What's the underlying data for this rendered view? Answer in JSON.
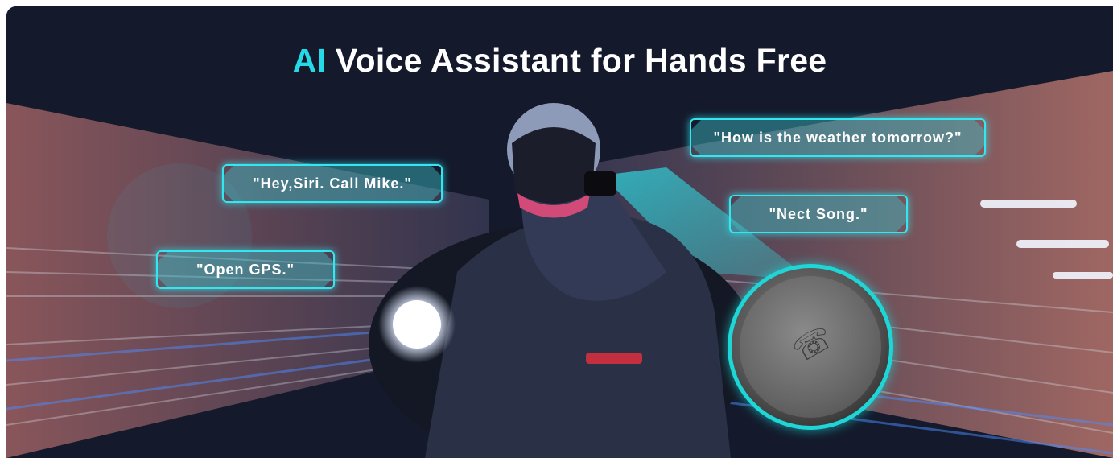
{
  "title": {
    "accent": "AI",
    "rest": " Voice Assistant for Hands Free"
  },
  "bubbles": {
    "weather": "\"How is the weather tomorrow?\"",
    "siri": "\"Hey,Siri. Call Mike.\"",
    "song": "\"Nect Song.\"",
    "gps": "\"Open GPS.\""
  },
  "colors": {
    "accent": "#26d9e6",
    "frame": "#33e6f0"
  },
  "device_icon": "phone-icon"
}
